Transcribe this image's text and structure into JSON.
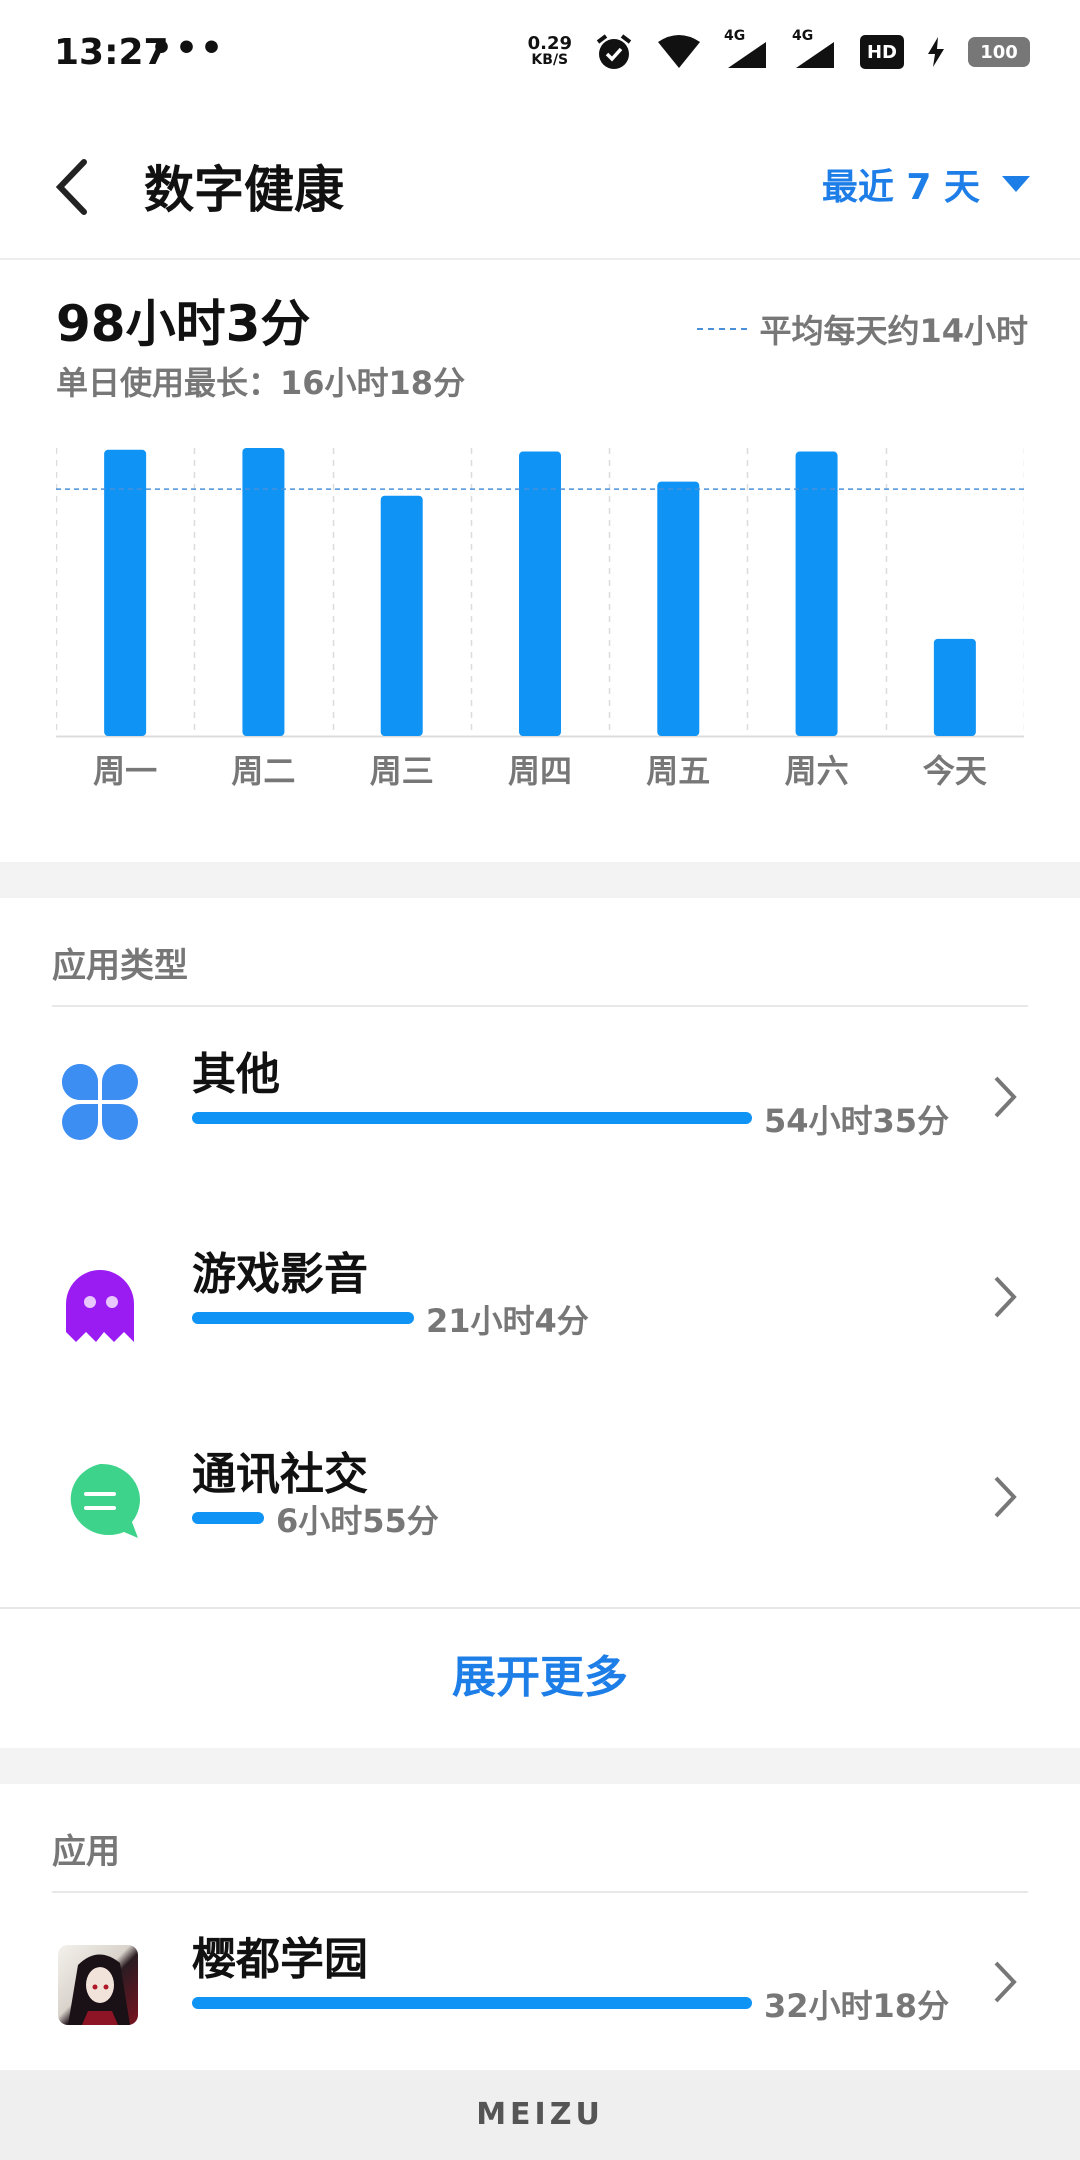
{
  "status_bar": {
    "time": "13:27",
    "dots": "•••",
    "net_speed_value": "0.29",
    "net_speed_unit": "KB/S",
    "signal1_label": "4G",
    "signal2_label": "4G",
    "hd_label": "HD",
    "battery": "100"
  },
  "header": {
    "title": "数字健康",
    "range_label": "最近 7 天"
  },
  "summary": {
    "total": "98小时3分",
    "max_day": "单日使用最长：16小时18分",
    "avg_label": "平均每天约14小时"
  },
  "chart_data": {
    "type": "bar",
    "categories": [
      "周一",
      "周二",
      "周三",
      "周四",
      "周五",
      "周六",
      "今天"
    ],
    "values": [
      16.2,
      16.3,
      13.6,
      16.1,
      14.4,
      16.1,
      5.5
    ],
    "average": 14,
    "ylim": [
      0,
      16.3
    ],
    "grid": true,
    "colors": {
      "bar": "#0f93f5",
      "avg_line": "#4a90d9"
    }
  },
  "categories_section": {
    "title": "应用类型",
    "items": [
      {
        "name": "其他",
        "duration": "54小时35分",
        "share": 0.556,
        "icon": "clover-icon"
      },
      {
        "name": "游戏影音",
        "duration": "21小时4分",
        "share": 0.215,
        "icon": "ghost-icon"
      },
      {
        "name": "通讯社交",
        "duration": "6小时55分",
        "share": 0.07,
        "icon": "chat-bubble-icon"
      }
    ],
    "expand_label": "展开更多"
  },
  "apps_section": {
    "title": "应用",
    "items": [
      {
        "name": "樱都学园",
        "duration": "32小时18分",
        "share": 0.556
      }
    ]
  },
  "brand": "MEIZU"
}
